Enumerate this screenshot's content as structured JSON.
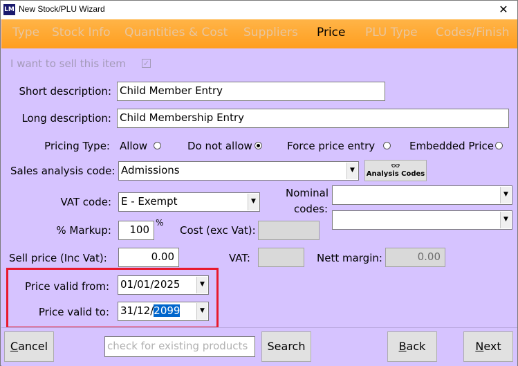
{
  "window": {
    "title": "New Stock/PLU Wizard",
    "app_icon_text": "LM",
    "close_glyph": "✕"
  },
  "tabs": [
    {
      "label": "Type",
      "active": false
    },
    {
      "label": "Stock Info",
      "active": false
    },
    {
      "label": "Quantities & Cost",
      "active": false
    },
    {
      "label": "Suppliers",
      "active": false
    },
    {
      "label": "Price",
      "active": true
    },
    {
      "label": "PLU Type",
      "active": false
    },
    {
      "label": "Codes/Finish",
      "active": false
    }
  ],
  "form": {
    "sell_item_label": "I want to sell this item",
    "sell_item_check": "✓",
    "short_desc_label": "Short description:",
    "short_desc_value": "Child Member Entry",
    "long_desc_label": "Long description:",
    "long_desc_value": "Child Membership Entry",
    "pricing_type_label": "Pricing Type:",
    "pricing_options": [
      "Allow",
      "Do not allow",
      "Force price entry",
      "Embedded Price"
    ],
    "pricing_selected": "Do not allow",
    "sales_analysis_label": "Sales analysis code:",
    "sales_analysis_value": "Admissions",
    "analysis_codes_button": "Analysis Codes",
    "vat_code_label": "VAT code:",
    "vat_code_value": "E - Exempt",
    "nominal_codes_label_1": "Nominal",
    "nominal_codes_label_2": "codes:",
    "markup_label": "% Markup:",
    "markup_value": "100",
    "markup_unit": "%",
    "cost_label": "Cost (exc Vat):",
    "cost_value": "",
    "sell_price_label": "Sell price (Inc Vat):",
    "sell_price_value": "0.00",
    "vat_label": "VAT:",
    "vat_value": "",
    "nett_margin_label": "Nett margin:",
    "nett_margin_value": "0.00",
    "valid_from_label": "Price valid from:",
    "valid_from_value": "01/01/2025",
    "valid_to_label": "Price valid to:",
    "valid_to_prefix": "31/12/",
    "valid_to_selected": "2099"
  },
  "footer": {
    "cancel_label": "Cancel",
    "cancel_underline": "C",
    "cancel_rest": "ancel",
    "search_placeholder": "check for existing products",
    "search_label": "Search",
    "back_underline": "B",
    "back_rest": "ack",
    "next_underline": "N",
    "next_rest": "ext"
  },
  "colors": {
    "background": "#d6c3ff",
    "tabbar": "#ffa530",
    "highlight": "#e8192c",
    "selection": "#0066cc"
  }
}
